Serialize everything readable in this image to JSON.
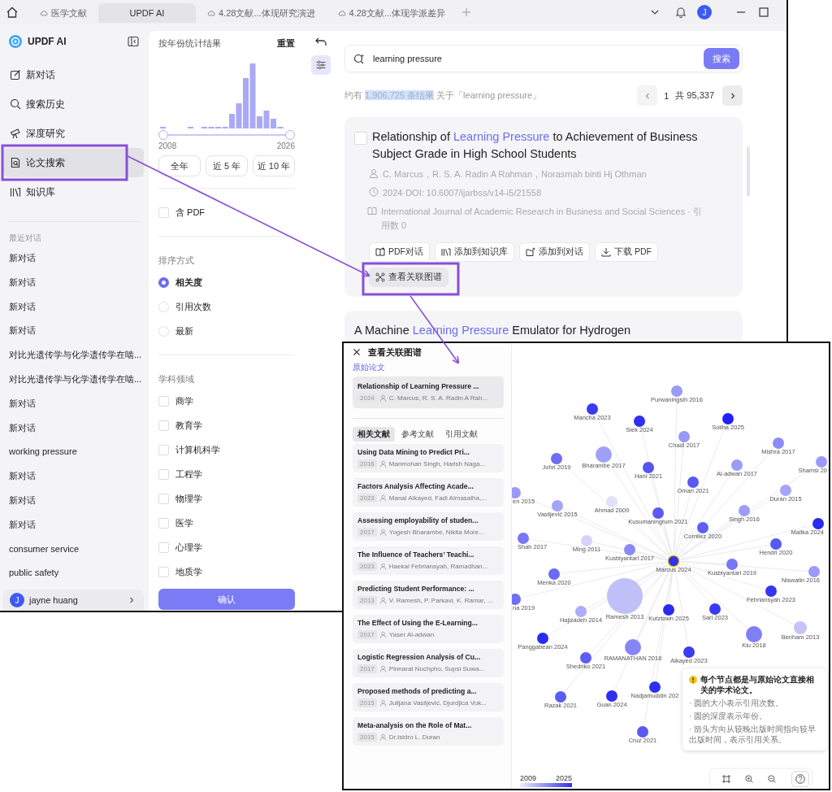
{
  "tabs": [
    {
      "label": "医学文献",
      "kind": "cloud",
      "selected": false
    },
    {
      "label": "UPDF AI",
      "kind": "app",
      "selected": true
    },
    {
      "label": "4.28文献...体现研究演进",
      "kind": "cloud",
      "selected": false
    },
    {
      "label": "4.28文献...体现学派差异",
      "kind": "cloud",
      "selected": false
    }
  ],
  "account_initial": "J",
  "sidebar": {
    "app_name": "UPDF AI",
    "nav": [
      {
        "label": "新对话",
        "kind": "compose",
        "selected": false
      },
      {
        "label": "搜索历史",
        "kind": "search",
        "selected": false
      },
      {
        "label": "深度研究",
        "kind": "telescope",
        "selected": false
      },
      {
        "label": "论文搜索",
        "kind": "paper",
        "selected": true
      },
      {
        "label": "知识库",
        "kind": "library",
        "selected": false
      }
    ],
    "recent_heading": "最近对话",
    "recent": [
      "新对话",
      "新对话",
      "新对话",
      "新对话",
      "对比光遗传学与化学遗传学在啮...",
      "对比光遗传学与化学遗传学在啮...",
      "新对话",
      "新对话",
      "working pressure",
      "新对话",
      "新对话",
      "新对话",
      "consumer service",
      "public safety"
    ],
    "user": {
      "initial": "J",
      "name": "jayne huang"
    }
  },
  "filters": {
    "year_title": "按年份统计结果",
    "reset": "重置",
    "year_start": "2008",
    "year_end": "2026",
    "handles": [
      {
        "level": 0
      },
      {
        "level": 1
      }
    ],
    "ranges": [
      "全年",
      "近 5 年",
      "近 10 年"
    ],
    "pdf_option": {
      "label": "含 PDF",
      "checked": false
    },
    "sort_title": "排序方式",
    "sort": [
      {
        "label": "相关度",
        "selected": true
      },
      {
        "label": "引用次数",
        "selected": false
      },
      {
        "label": "最新",
        "selected": false
      }
    ],
    "field_title": "学科领域",
    "fields": [
      {
        "label": "商学",
        "checked": false
      },
      {
        "label": "教育学",
        "checked": false
      },
      {
        "label": "计算机科学",
        "checked": false
      },
      {
        "label": "工程学",
        "checked": false
      },
      {
        "label": "物理学",
        "checked": false
      },
      {
        "label": "医学",
        "checked": false
      },
      {
        "label": "心理学",
        "checked": false
      },
      {
        "label": "地质学",
        "checked": false
      }
    ],
    "confirm": "确认"
  },
  "search": {
    "query": "learning pressure",
    "button": "搜索"
  },
  "summary": {
    "before": "约有 ",
    "highlight": "1,906,725 条结果",
    "after": " 关于「learning pressure」"
  },
  "pagination": {
    "page": "1",
    "total": "共 95,337"
  },
  "results": [
    {
      "checked": false,
      "title": [
        {
          "text": "Relationship of ",
          "match": false
        },
        {
          "text": "Learning Pressure",
          "match": true
        },
        {
          "text": " to Achievement of Business Subject Grade in High School Students",
          "match": false
        }
      ],
      "authors": "C. Marcus，R. S. A. Radin A Rahman，Norasmah binti Hj Othman",
      "date": "2024·DOI: 10.6007/ijarbss/v14-i5/21558",
      "journal": "International Journal of Academic Research in Business and Social Sciences · 引用数 0",
      "actions": [
        {
          "label": "PDF对话",
          "kind": "chat"
        },
        {
          "label": "添加到知识库",
          "kind": "library"
        },
        {
          "label": "添加到对话",
          "kind": "add"
        },
        {
          "label": "下载 PDF",
          "kind": "download"
        },
        {
          "label": "查看关联图谱",
          "kind": "graph"
        }
      ]
    },
    {
      "title": [
        {
          "text": "A Machine ",
          "match": false
        },
        {
          "text": "Learning Pressure",
          "match": true
        },
        {
          "text": " Emulator for Hydrogen",
          "match": false
        }
      ]
    }
  ],
  "graph": {
    "title": "查看关联图谱",
    "original_label": "原始论文",
    "original": {
      "title": "Relationship of Learning Pressure ...",
      "year": "2024",
      "authors": "C. Marcus, R. S. A. Radin A Rah..."
    },
    "tabs": [
      {
        "label": "相关文献",
        "selected": true
      },
      {
        "label": "参考文献",
        "selected": false
      },
      {
        "label": "引用文献",
        "selected": false
      }
    ],
    "papers": [
      {
        "title": "Using Data Mining to Predict Pri...",
        "year": "2016",
        "authors": "Manmohan Singh, Harish Naga..."
      },
      {
        "title": "Factors Analysis Affecting Acade...",
        "year": "2023",
        "authors": "Manal Alkayed, Fadi Almasalha,..."
      },
      {
        "title": "Assessing employability of studen...",
        "year": "2017",
        "authors": "Yogesh Bharambe, Nikita More..."
      },
      {
        "title": "The Influence of Teachers’ Teachi...",
        "year": "2023",
        "authors": "Haekal Febriansyah, Ramadhan..."
      },
      {
        "title": "Predicting Student Performance: ...",
        "year": "2013",
        "authors": "V. Ramesh, P. Parkavi, K. Ramar, ..."
      },
      {
        "title": "The Effect of Using the E-Learning...",
        "year": "2017",
        "authors": "Yaser Al-adwan"
      },
      {
        "title": "Logistic Regression Analysis of Cu...",
        "year": "2017",
        "authors": "Pinnarat Nuchpho, Supsi Suwa..."
      },
      {
        "title": "Proposed methods of predicting a...",
        "year": "2015",
        "authors": "Julijana Vasiljević, Djurdjica Vuk..."
      },
      {
        "title": "Meta-analysis on the Role of Mat...",
        "year": "2015",
        "authors": "Dr.Isidro L. Duran"
      }
    ],
    "nodes": [
      {
        "label": "Purwaningsih 2016",
        "kind": "paper",
        "color": "#9a9af8"
      },
      {
        "label": "Mancha 2023",
        "kind": "paper",
        "color": "#3a3af5"
      },
      {
        "label": "Siek 2024",
        "kind": "paper",
        "color": "#2e2ef5"
      },
      {
        "label": "Soliha 2025",
        "kind": "paper",
        "color": "#2020f0"
      },
      {
        "label": "Chadi 2017",
        "kind": "paper",
        "color": "#9898f8"
      },
      {
        "label": "Mishra 2017",
        "kind": "paper",
        "color": "#8c8cf8"
      },
      {
        "label": "Johri 2019",
        "kind": "paper",
        "color": "#6d6df5"
      },
      {
        "label": "Bharambe 2017",
        "kind": "paper",
        "color": "#a0a0f8"
      },
      {
        "label": "Hani 2021",
        "kind": "paper",
        "color": "#5555f2"
      },
      {
        "label": "Al-adwan 2017",
        "kind": "paper",
        "color": "#9b9bf8"
      },
      {
        "label": "Shamsi 20",
        "kind": "paper",
        "color": "#9a9af8"
      },
      {
        "label": "Omari 2021",
        "kind": "paper",
        "color": "#5858f2"
      },
      {
        "label": "en 2015",
        "kind": "paper",
        "color": "#9a9af8"
      },
      {
        "label": "Duran 2015",
        "kind": "paper",
        "color": "#a4a4f8"
      },
      {
        "label": "Vasiljević 2015",
        "kind": "paper",
        "color": "#a4a4f8"
      },
      {
        "label": "Ahmad 2009",
        "kind": "paper",
        "color": "#e0e0fa"
      },
      {
        "label": "Kusumaningrum 2021",
        "kind": "paper",
        "color": "#5a5af3"
      },
      {
        "label": "Singh 2016",
        "kind": "paper",
        "color": "#9c9cf8"
      },
      {
        "label": "Cornilez 2020",
        "kind": "paper",
        "color": "#5e5ef3"
      },
      {
        "label": "Mallka 2024",
        "kind": "paper",
        "color": "#2a2af2"
      },
      {
        "label": "Shah 2017",
        "kind": "paper",
        "color": "#7777f5"
      },
      {
        "label": "Ming 2011",
        "kind": "paper",
        "color": "#d4d4fa"
      },
      {
        "label": "Kusbiyantari 2017",
        "kind": "paper",
        "color": "#8a8af6"
      },
      {
        "label": "Hendri 2020",
        "kind": "paper",
        "color": "#5858f2"
      },
      {
        "label": "Marcus 2024",
        "kind": "origin",
        "color": "#3333ee"
      },
      {
        "label": "Kusbiyantari 2019",
        "kind": "paper",
        "color": "#7878f5"
      },
      {
        "label": "Niswatin 2016",
        "kind": "paper",
        "color": "#9a9af8"
      },
      {
        "label": "Menka 2020",
        "kind": "paper",
        "color": "#6a6af4"
      },
      {
        "label": "Febriansyah 2023",
        "kind": "paper",
        "color": "#3636f2"
      },
      {
        "label": "na 2019",
        "kind": "paper",
        "color": "#7070f4"
      },
      {
        "label": "Ramesh 2013",
        "kind": "paper",
        "color": "#c0c0f8"
      },
      {
        "label": "Kutztown 2025",
        "kind": "paper",
        "color": "#2a2af0"
      },
      {
        "label": "Sari 2023",
        "kind": "paper",
        "color": "#3a3af2"
      },
      {
        "label": "Hajizadeh 2014",
        "kind": "paper",
        "color": "#adadf8"
      },
      {
        "label": "Benham 2013",
        "kind": "paper",
        "color": "#c4c4f8"
      },
      {
        "label": "Kiu 2018",
        "kind": "paper",
        "color": "#8080f5"
      },
      {
        "label": "Panggabean 2024",
        "kind": "paper",
        "color": "#2c2cf0"
      },
      {
        "label": "RAMANATHAN 2018",
        "kind": "paper",
        "color": "#8585f5"
      },
      {
        "label": "Shedriko 2021",
        "kind": "paper",
        "color": "#5e5ef3"
      },
      {
        "label": "Alkayed 2023",
        "kind": "paper",
        "color": "#3c3cf2"
      },
      {
        "label": "Nadjamuddin 202",
        "kind": "paper",
        "color": "#3030f0"
      },
      {
        "label": "Razak 2021",
        "kind": "paper",
        "color": "#5c5cf3"
      },
      {
        "label": "Guan 2024",
        "kind": "paper",
        "color": "#2e2ef0"
      },
      {
        "label": "Cruz 2021",
        "kind": "paper",
        "color": "#5a5af3"
      }
    ],
    "tooltip": {
      "title": "每个节点都是与原始论文直接相关的学术论文。",
      "notes": [
        "· 圆的大小表示引用次数。",
        "· 圆的深度表示年份。",
        "· 箭头方向从较晚出版时间指向较早出版时间，表示引用关系。"
      ]
    },
    "legend": {
      "start": "2009",
      "end": "2025"
    }
  }
}
